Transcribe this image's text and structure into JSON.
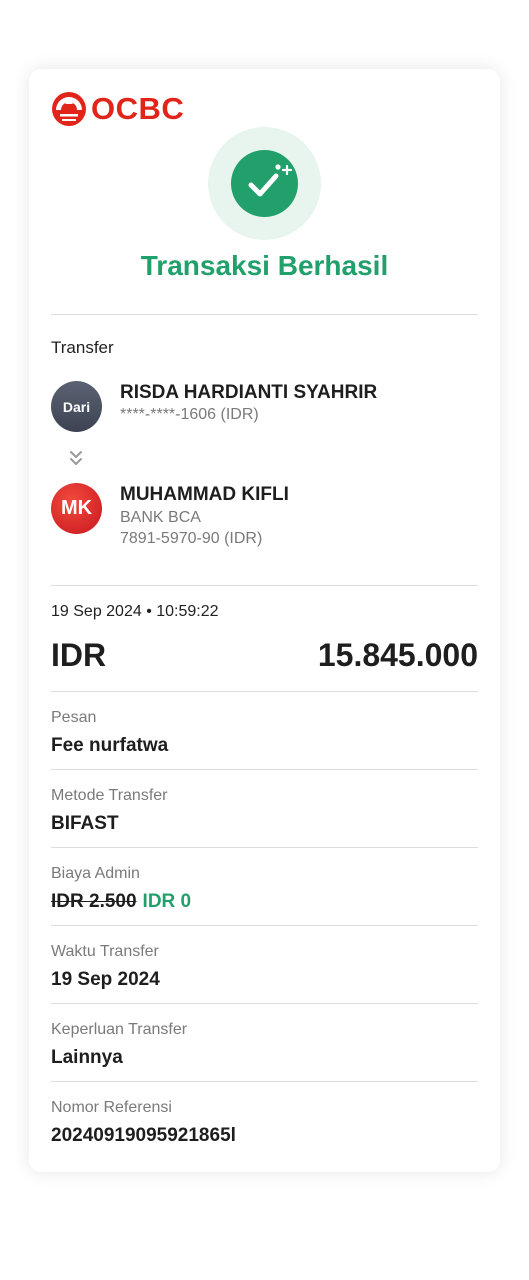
{
  "brand": {
    "logo_text": "OCBC",
    "logo_color": "#E1251B"
  },
  "status": {
    "title": "Transaksi Berhasil",
    "icon": "check-sparkle-icon",
    "color": "#22A06B"
  },
  "transfer": {
    "section_label": "Transfer",
    "from": {
      "avatar_text": "Dari",
      "name": "RISDA HARDIANTI SYAHRIR",
      "account": "****-****-1606 (IDR)"
    },
    "to": {
      "avatar_text": "MK",
      "name": "MUHAMMAD KIFLI",
      "bank": "BANK BCA",
      "account": "7891-5970-90 (IDR)"
    }
  },
  "summary": {
    "datetime": "19 Sep 2024 • 10:59:22",
    "currency": "IDR",
    "amount": "15.845.000"
  },
  "details": {
    "message": {
      "label": "Pesan",
      "value": "Fee nurfatwa"
    },
    "method": {
      "label": "Metode Transfer",
      "value": "BIFAST"
    },
    "fee": {
      "label": "Biaya Admin",
      "original": "IDR 2.500",
      "value": "IDR 0"
    },
    "time": {
      "label": "Waktu Transfer",
      "value": "19 Sep 2024"
    },
    "purpose": {
      "label": "Keperluan Transfer",
      "value": "Lainnya"
    },
    "reference": {
      "label": "Nomor Referensi",
      "value": "20240919095921865l"
    }
  }
}
